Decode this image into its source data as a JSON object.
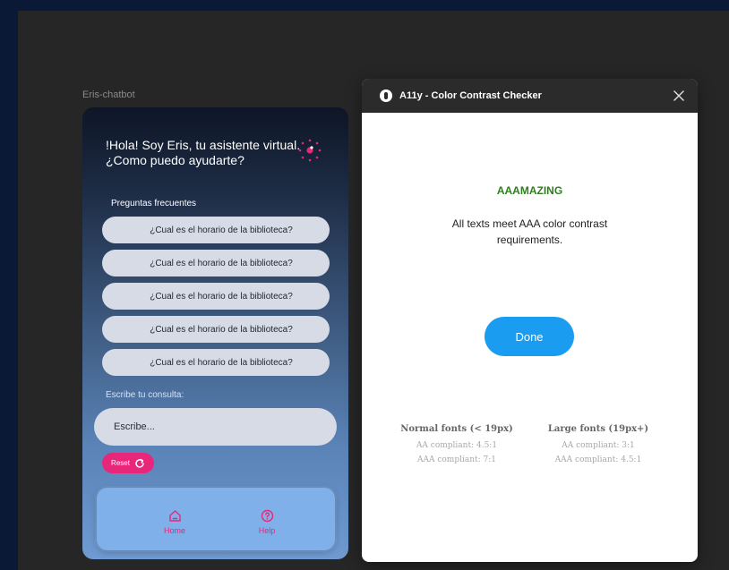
{
  "frame": {
    "label": "Eris-chatbot"
  },
  "chat": {
    "greeting": "!Hola! Soy Eris, tu asistente virtual. ¿Como puedo ayudarte?",
    "faq_title": "Preguntas frecuentes",
    "faq_items": [
      "¿Cual es el horario de la biblioteca?",
      "¿Cual es el horario de la biblioteca?",
      "¿Cual es el horario de la biblioteca?",
      "¿Cual es el horario de la biblioteca?",
      "¿Cual es el horario de la biblioteca?"
    ],
    "query_label": "Escribe tu consulta:",
    "query_placeholder": "Escribe...",
    "reset_label": "Reset",
    "reset_icon": "refresh-icon",
    "assistant_icon": "sparkle-dots-icon",
    "nav": [
      {
        "label": "Home",
        "icon": "home-icon"
      },
      {
        "label": "Help",
        "icon": "help-circle-icon"
      }
    ]
  },
  "plugin": {
    "title": "A11y - Color Contrast Checker",
    "result_title": "AAAMAZING",
    "result_desc": "All texts meet AAA color contrast requirements.",
    "done_label": "Done",
    "normal_fonts": {
      "head": "Normal fonts (< 19px)",
      "aa": "AA compliant: 4.5:1",
      "aaa": "AAA compliant: 7:1"
    },
    "large_fonts": {
      "head": "Large fonts (19px+)",
      "aa": "AA compliant: 3:1",
      "aaa": "AAA compliant: 4.5:1"
    }
  },
  "colors": {
    "accent_pink": "#e8267a",
    "done_blue": "#1a9cf0",
    "success_green": "#2e7d1f",
    "page_bg": "#0a1a36",
    "canvas_bg": "#262626"
  }
}
